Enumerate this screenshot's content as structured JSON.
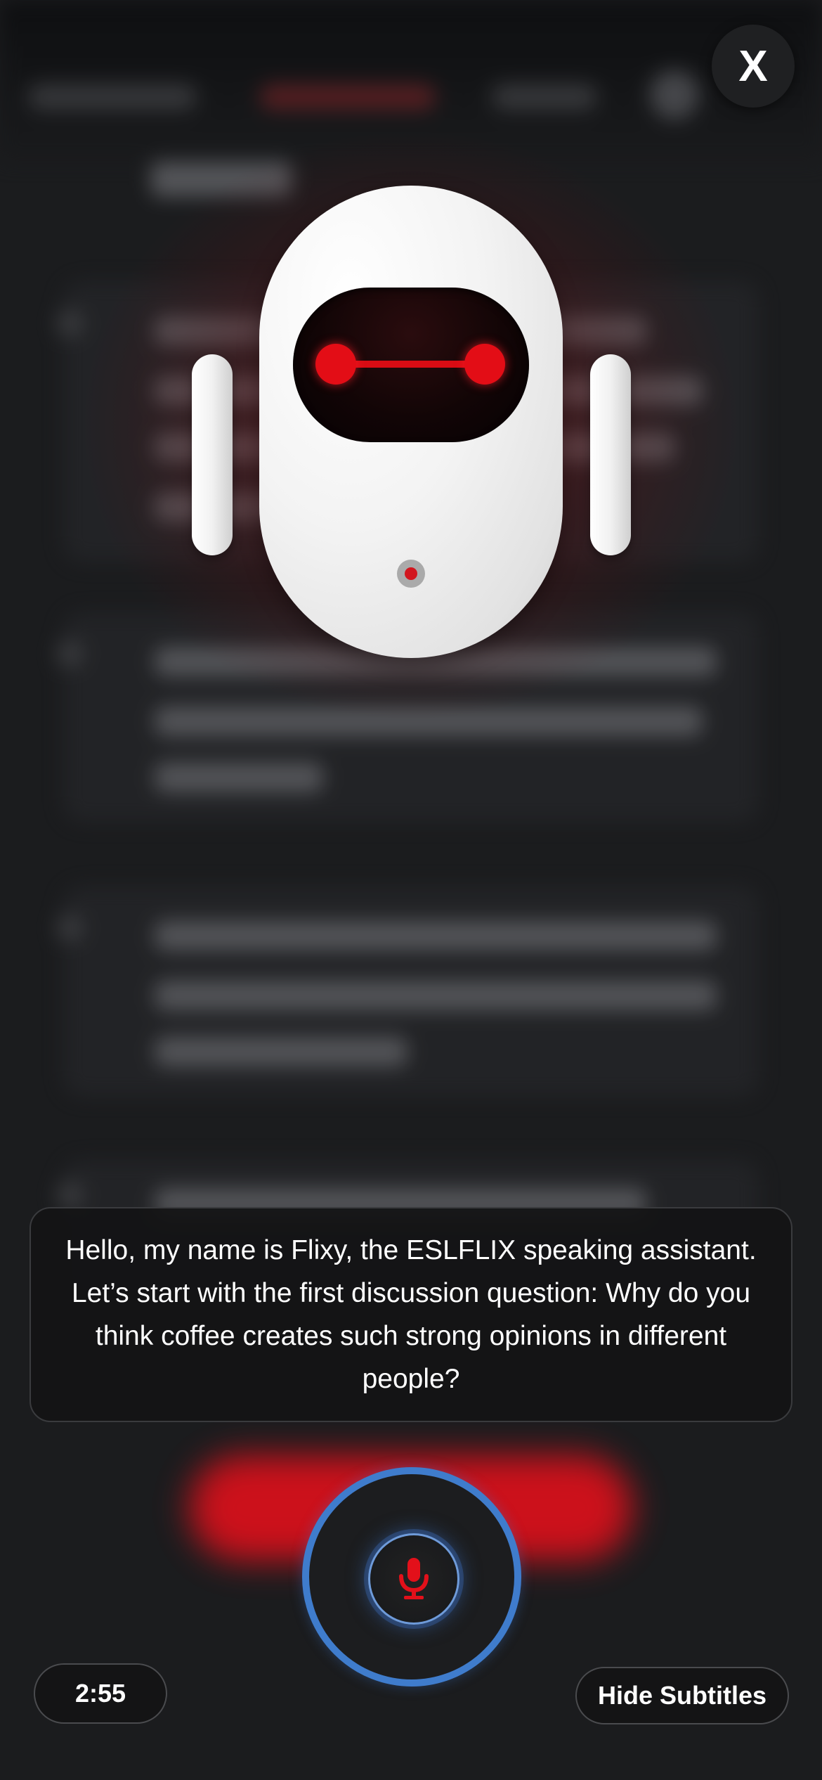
{
  "close_button": {
    "label": "X"
  },
  "assistant": {
    "subtitle": "Hello, my name is Flixy, the ESLFLIX speaking assistant. Let’s start with the first discussion question: Why do you think coffee creates such strong opinions in different people?"
  },
  "controls": {
    "timer": "2:55",
    "hide_subtitles_label": "Hide Subtitles"
  },
  "colors": {
    "accent_red": "#e30d16",
    "mic_ring_blue": "#3f7ccc",
    "background": "#1b1c1e"
  },
  "icons": [
    "close-icon",
    "microphone-icon",
    "robot-avatar"
  ]
}
